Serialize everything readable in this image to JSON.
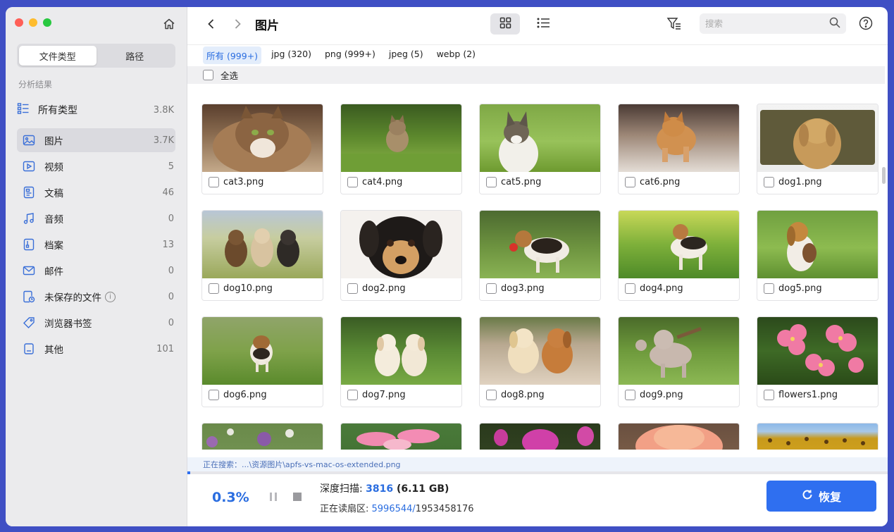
{
  "sidebar": {
    "segments": [
      "文件类型",
      "路径"
    ],
    "section_label": "分析结果",
    "all_types": {
      "label": "所有类型",
      "count": "3.8K"
    },
    "categories": [
      {
        "label": "图片",
        "count": "3.7K",
        "icon": "image-icon"
      },
      {
        "label": "视频",
        "count": "5",
        "icon": "video-icon"
      },
      {
        "label": "文稿",
        "count": "46",
        "icon": "document-icon"
      },
      {
        "label": "音频",
        "count": "0",
        "icon": "music-icon"
      },
      {
        "label": "档案",
        "count": "13",
        "icon": "archive-icon"
      },
      {
        "label": "邮件",
        "count": "0",
        "icon": "mail-icon"
      },
      {
        "label": "未保存的文件",
        "count": "0",
        "icon": "unsaved-file-icon",
        "info": "i"
      },
      {
        "label": "浏览器书签",
        "count": "0",
        "icon": "bookmark-tag-icon"
      },
      {
        "label": "其他",
        "count": "101",
        "icon": "other-file-icon"
      }
    ]
  },
  "toolbar": {
    "title": "图片",
    "search_placeholder": "搜索"
  },
  "filter_tabs": [
    "所有 (999+)",
    "jpg (320)",
    "png (999+)",
    "jpeg (5)",
    "webp (2)"
  ],
  "select_all_label": "全选",
  "files": [
    "cat3.png",
    "cat4.png",
    "cat5.png",
    "cat6.png",
    "dog1.png",
    "dog10.png",
    "dog2.png",
    "dog3.png",
    "dog4.png",
    "dog5.png",
    "dog6.png",
    "dog7.png",
    "dog8.png",
    "dog9.png",
    "flowers1.png"
  ],
  "status": {
    "searching": "正在搜索：...\\资源图片\\apfs-vs-mac-os-extended.png",
    "percent": "0.3%",
    "progress_fraction": 0.003,
    "deep_scan_label": "深度扫描: ",
    "deep_scan_count": "3816",
    "deep_scan_size": " (6.11 GB)",
    "reading_label": "正在读扇区: ",
    "reading_current": "5996544/",
    "reading_total": "1953458176"
  },
  "recover_button": "恢复",
  "colors": {
    "accent": "#2f6ff0",
    "window_frame": "#3f4fc4",
    "sidebar_bg": "#ebebed"
  }
}
